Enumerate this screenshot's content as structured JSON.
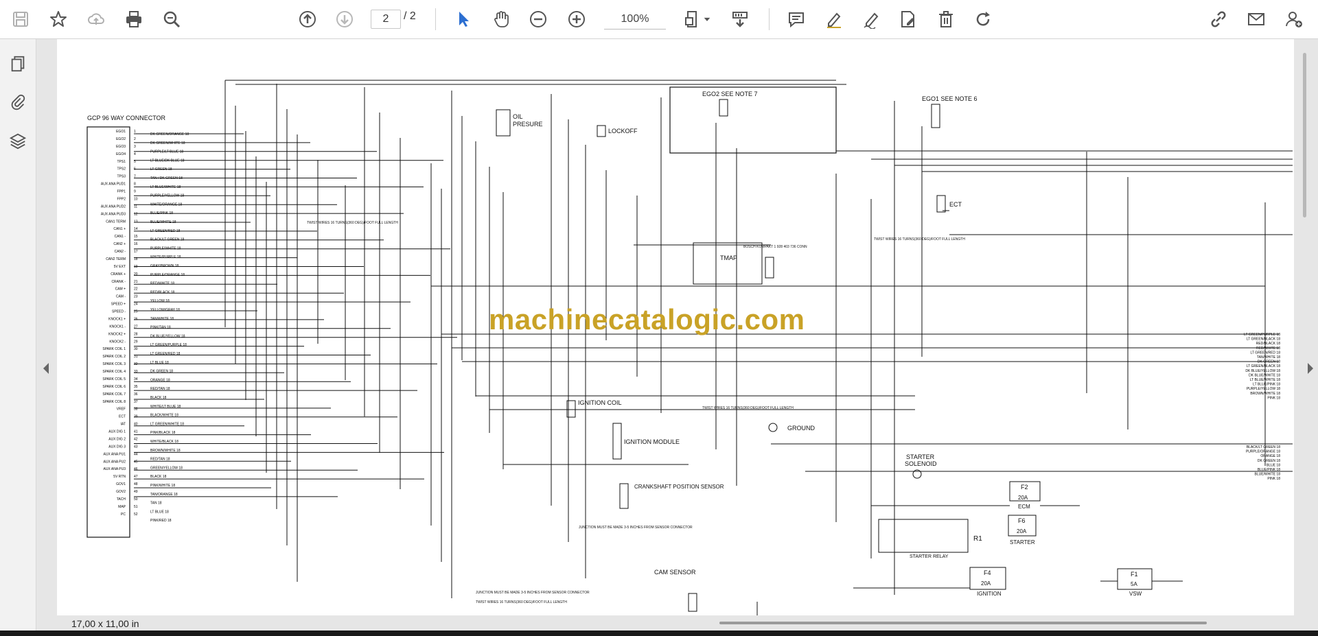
{
  "toolbar": {
    "current_page": "2",
    "total_pages": "/ 2",
    "zoom": "100%"
  },
  "status": {
    "page_size": "17,00 x 11,00 in"
  },
  "watermark": "machinecatalogic.com",
  "diagram": {
    "connector_title": "GCP 96 WAY CONNECTOR",
    "ego2": "EGO2  SEE NOTE 7",
    "ego1": "EGO1  SEE NOTE 6",
    "oil": "OIL",
    "presure": "PRESURE",
    "lockoff": "LOCKOFF",
    "ect": "ECT",
    "tmap": "TMAP",
    "ignition_coil": "IGNITION COIL",
    "ignition_module": "IGNITION MODULE",
    "ground": "GROUND",
    "crankshaft": "CRANKSHAFT POSITION SENSOR",
    "cam_sensor": "CAM SENSOR",
    "starter_solenoid_1": "STARTER",
    "starter_solenoid_2": "SOLENOID",
    "r1": "R1",
    "starter_relay": "STARTER RELAY",
    "f2": "F2",
    "f2_amp": "20A",
    "ecm": "ECM",
    "f6": "F6",
    "f6_amp": "20A",
    "starter": "STARTER",
    "f4": "F4",
    "f4_amp": "20A",
    "ignition": "IGNITION",
    "f1": "F1",
    "f1_amp": "5A",
    "vsw": "VSW",
    "twist_note": "TWIST WIRES 16 TURNS(360 DEG)/FOOT FULL LENGTH",
    "junction_note": "JUNCTION MUST BE MADE 3-5 INCHES FROM SENSOR CONNECTOR",
    "bosch": "BOSCH KOMPAKT 1 928 403 736 CONN",
    "pin_labels": [
      "EGO1",
      "EGO2",
      "EGO3",
      "EGO4",
      "TPS1",
      "TPS2",
      "TPS3",
      "AUX ANA PUD1",
      "FPP1",
      "FPP2",
      "AUX ANA PUD2",
      "AUX ANA PUD3",
      "CAN1 TERM",
      "CAN1 +",
      "CAN1 -",
      "CAN2 +",
      "CAN2 -",
      "CAN2 TERM",
      "5V EXT",
      "CRANK +",
      "CRANK -",
      "CAM +",
      "CAM -",
      "SPEED +",
      "SPEED -",
      "KNOCK1 +",
      "KNOCK1 -",
      "KNOCK2 +",
      "KNOCK2 -",
      "SPARK COIL 1",
      "SPARK COIL 2",
      "SPARK COIL 3",
      "SPARK COIL 4",
      "SPARK COIL 5",
      "SPARK COIL 6",
      "SPARK COIL 7",
      "SPARK COIL 8",
      "VREF",
      "ECT",
      "IAT",
      "AUX DIG 1",
      "AUX DIG 2",
      "AUX DIG 3",
      "AUX ANA PU1",
      "AUX ANA PU2",
      "AUX ANA PU3",
      "5V RTN",
      "GOV1",
      "GOV2",
      "TACH",
      "MAP",
      "PC"
    ],
    "wire_labels": [
      "DK GREEN/ORANGE 18",
      "DK GREEN/WHITE 18",
      "PURPLE/LT BLUE 18",
      "LT BLUE/DK BLUE 18",
      "LT GREEN 18",
      "TAN / DK GREEN 18",
      "LT BLUE/WHITE 18",
      "PURPLE/YELLOW 18",
      "WHITE/ORANGE 18",
      "BLUE/PINK 18",
      "BLUE/WHITE 18",
      "LT GREEN/RED 18",
      "BLACK/LT GREEN 18",
      "PURPLE/WHITE 18",
      "WHITE/PURPLE 18",
      "GRAY/BROWN 18",
      "PURPLE/ORANGE 18",
      "RED/WHITE 18",
      "RED/BLACK 18",
      "YELLOW 18",
      "YELLOW/GRAY 18",
      "TAN/WHITE 18",
      "PINK/TAN 18",
      "DK BLUE/YELLOW 18",
      "LT GREEN/PURPLE 18",
      "LT GREEN/RED 18",
      "LT BLUE 18",
      "DK GREEN 18",
      "ORANGE 18",
      "RED/TAN 18",
      "BLACK 18",
      "WHITE/LT BLUE 18",
      "BLACK/WHITE 18",
      "LT GREEN/WHITE 18",
      "PINK/BLACK 18",
      "WHITE/BLACK 18",
      "BROWN/WHITE 18",
      "RED/TAN 18",
      "GREEN/YELLOW 18",
      "BLACK 18",
      "PINK/WHITE 18",
      "TAN/ORANGE 18",
      "TAN 18",
      "LT BLUE 18",
      "PINK/RED 18"
    ],
    "right_labels": [
      "LT GREEN/PURPLE 18",
      "LT GREEN/BLACK 18",
      "RED/BLACK 18",
      "RED/WHITE 18",
      "LT GREEN/RED 18",
      "TAN/WHITE 18",
      "DK GREEN 18",
      "LT GREEN/BLACK 18",
      "DK BLUE/YELLOW 18",
      "DK BLUE/WHITE 18",
      "LT BLUE/WHITE 18",
      "LT BLUE/PINK 18",
      "PURPLE/YELLOW 18",
      "BROWN/WHITE 18",
      "PINK 18",
      "BLACK/LT GREEN 18",
      "PURPLE/ORANGE 18",
      "ORANGE 18",
      "DK GREEN 18",
      "BLUE 18",
      "BLUE/PINK 18",
      "BLUE/WHITE 18",
      "PINK 18"
    ]
  }
}
